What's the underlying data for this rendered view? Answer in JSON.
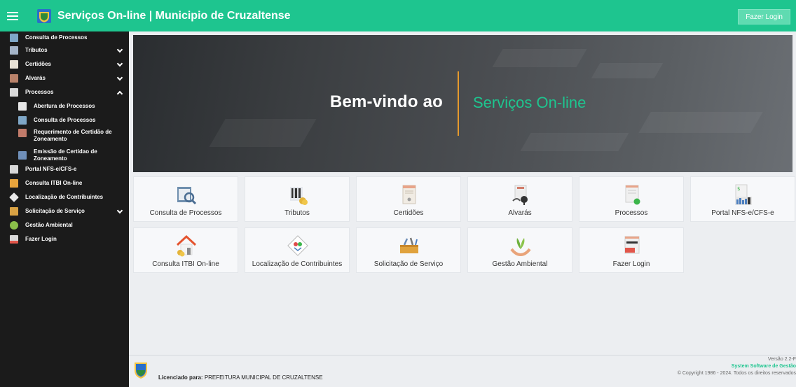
{
  "header": {
    "title": "Serviços On-line | Municipio de Cruzaltense",
    "login_button": "Fazer Login",
    "menu_icon": "hamburger-icon",
    "brand_color": "#1ec58f"
  },
  "sidebar": {
    "items": [
      {
        "label": "Consulta de Processos",
        "icon": "search-document-icon"
      },
      {
        "label": "Tributos",
        "icon": "barcode-icon"
      },
      {
        "label": "Certidões",
        "icon": "certificate-icon"
      },
      {
        "label": "Alvarás",
        "icon": "permit-icon"
      },
      {
        "label": "Processos",
        "icon": "process-icon"
      },
      {
        "label": "Abertura de Processos",
        "icon": "open-process-icon"
      },
      {
        "label": "Consulta de Processos",
        "icon": "search-document-icon"
      },
      {
        "label": "Requerimento de Certidão de Zoneamento",
        "icon": "request-icon"
      },
      {
        "label": "Emissão de Certidao de Zoneamento",
        "icon": "emission-icon"
      },
      {
        "label": "Portal NFS-e/CFS-e",
        "icon": "invoice-icon"
      },
      {
        "label": "Consulta ITBI On-line",
        "icon": "house-icon"
      },
      {
        "label": "Localização de Contribuintes",
        "icon": "map-pin-icon"
      },
      {
        "label": "Solicitação de Serviço",
        "icon": "toolbox-icon"
      },
      {
        "label": "Gestão Ambiental",
        "icon": "plant-icon"
      },
      {
        "label": "Fazer Login",
        "icon": "login-icon"
      }
    ]
  },
  "hero": {
    "left_text": "Bem-vindo ao",
    "right_text": "Serviços On-line",
    "accent_color": "#e69a2c"
  },
  "cards": [
    {
      "label": "Consulta de Processos",
      "icon": "search-document-icon"
    },
    {
      "label": "Tributos",
      "icon": "barcode-icon"
    },
    {
      "label": "Certidões",
      "icon": "certificate-icon"
    },
    {
      "label": "Alvarás",
      "icon": "permit-icon"
    },
    {
      "label": "Processos",
      "icon": "process-icon"
    },
    {
      "label": "Portal NFS-e/CFS-e",
      "icon": "invoice-icon"
    },
    {
      "label": "Consulta ITBI On-line",
      "icon": "house-icon"
    },
    {
      "label": "Localização de Contribuintes",
      "icon": "map-pin-icon"
    },
    {
      "label": "Solicitação de Serviço",
      "icon": "toolbox-icon"
    },
    {
      "label": "Gestão Ambiental",
      "icon": "plant-icon"
    },
    {
      "label": "Fazer Login",
      "icon": "login-icon"
    }
  ],
  "footer": {
    "license_prefix": "Licenciado para:",
    "license_name": "PREFEITURA MUNICIPAL DE CRUZALTENSE",
    "version": "Versão 2.2-F",
    "system": "System Software de Gestão",
    "copyright": "© Copyright 1986 - 2024. Todos os direitos reservados"
  }
}
